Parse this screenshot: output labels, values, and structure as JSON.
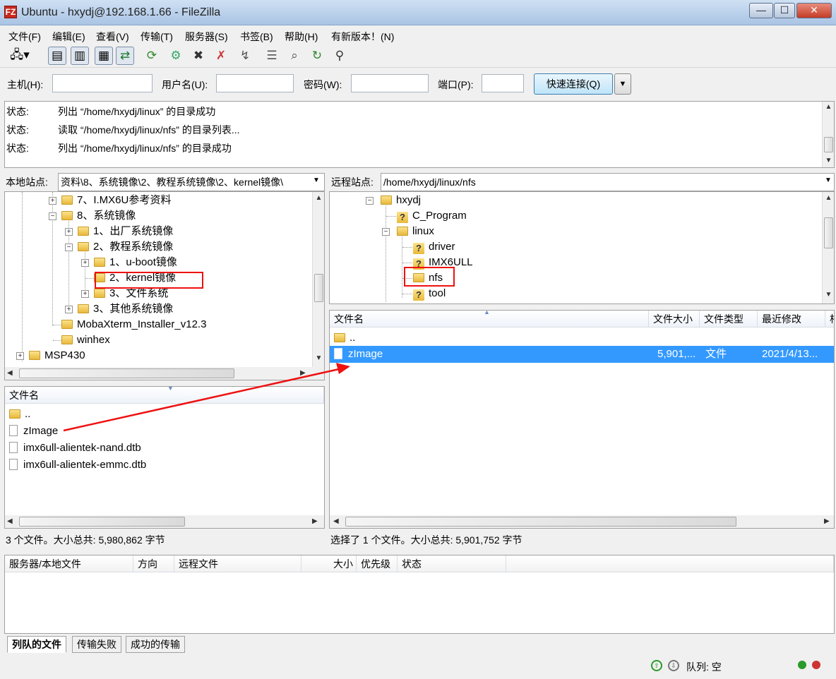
{
  "window": {
    "title": "Ubuntu - hxydj@192.168.1.66 - FileZilla",
    "app_icon": "FZ",
    "controls": [
      "—",
      "☐",
      "✕"
    ]
  },
  "menu": [
    "文件(F)",
    "编辑(E)",
    "查看(V)",
    "传输(T)",
    "服务器(S)",
    "书签(B)",
    "帮助(H)",
    "有新版本！(N)"
  ],
  "quickconnect": {
    "host_label": "主机(H):",
    "host_value": "",
    "user_label": "用户名(U):",
    "user_value": "",
    "pass_label": "密码(W):",
    "pass_value": "",
    "port_label": "端口(P):",
    "port_value": "",
    "connect_label": "快速连接(Q)"
  },
  "log": [
    {
      "label": "状态:",
      "message": "列出 “/home/hxydj/linux” 的目录成功"
    },
    {
      "label": "状态:",
      "message": "读取 “/home/hxydj/linux/nfs” 的目录列表..."
    },
    {
      "label": "状态:",
      "message": "列出 “/home/hxydj/linux/nfs” 的目录成功"
    }
  ],
  "local": {
    "site_label": "本地站点:",
    "site_path": "资料\\8、系统镜像\\2、教程系统镜像\\2、kernel镜像\\",
    "tree": [
      {
        "label": "7、I.MX6U参考资料",
        "expander": "+"
      },
      {
        "label": "8、系统镜像",
        "expander": "−"
      },
      {
        "label": "1、出厂系统镜像",
        "expander": "+"
      },
      {
        "label": "2、教程系统镜像",
        "expander": "−"
      },
      {
        "label": "1、u-boot镜像",
        "expander": "+"
      },
      {
        "label": "2、kernel镜像",
        "expander": ""
      },
      {
        "label": "3、文件系统",
        "expander": "+"
      },
      {
        "label": "3、其他系统镜像",
        "expander": "+"
      },
      {
        "label": "MobaXterm_Installer_v12.3",
        "expander": ""
      },
      {
        "label": "winhex",
        "expander": ""
      },
      {
        "label": "MSP430",
        "expander": "+"
      }
    ],
    "list_header": "文件名",
    "files": [
      {
        "name": "..",
        "kind": "folder"
      },
      {
        "name": "zImage",
        "kind": "file"
      },
      {
        "name": "imx6ull-alientek-nand.dtb",
        "kind": "file"
      },
      {
        "name": "imx6ull-alientek-emmc.dtb",
        "kind": "file"
      }
    ],
    "status": "3 个文件。大小总共: 5,980,862 字节"
  },
  "remote": {
    "site_label": "远程站点:",
    "site_path": "/home/hxydj/linux/nfs",
    "tree": [
      {
        "label": "hxydj",
        "expander": "−",
        "icon": "folder"
      },
      {
        "label": "C_Program",
        "expander": "",
        "icon": "unknown-folder"
      },
      {
        "label": "linux",
        "expander": "−",
        "icon": "folder"
      },
      {
        "label": "driver",
        "expander": "",
        "icon": "unknown-folder"
      },
      {
        "label": "IMX6ULL",
        "expander": "",
        "icon": "unknown-folder"
      },
      {
        "label": "nfs",
        "expander": "",
        "icon": "folder"
      },
      {
        "label": "tool",
        "expander": "",
        "icon": "unknown-folder"
      }
    ],
    "columns": [
      "文件名",
      "文件大小",
      "文件类型",
      "最近修改",
      "相"
    ],
    "files": [
      {
        "name": "..",
        "size": "",
        "type": "",
        "modified": "",
        "kind": "folder"
      },
      {
        "name": "zImage",
        "size": "5,901,...",
        "type": "文件",
        "modified": "2021/4/13...",
        "kind": "file",
        "selected": true
      }
    ],
    "status": "选择了 1 个文件。大小总共: 5,901,752 字节"
  },
  "queue": {
    "columns": [
      "服务器/本地文件",
      "方向",
      "远程文件",
      "大小",
      "优先级",
      "状态"
    ],
    "tabs": [
      "列队的文件",
      "传输失败",
      "成功的传输"
    ],
    "footer": "队列: 空"
  },
  "colors": {
    "selection": "#3399ff",
    "annotation": "#e11111"
  }
}
